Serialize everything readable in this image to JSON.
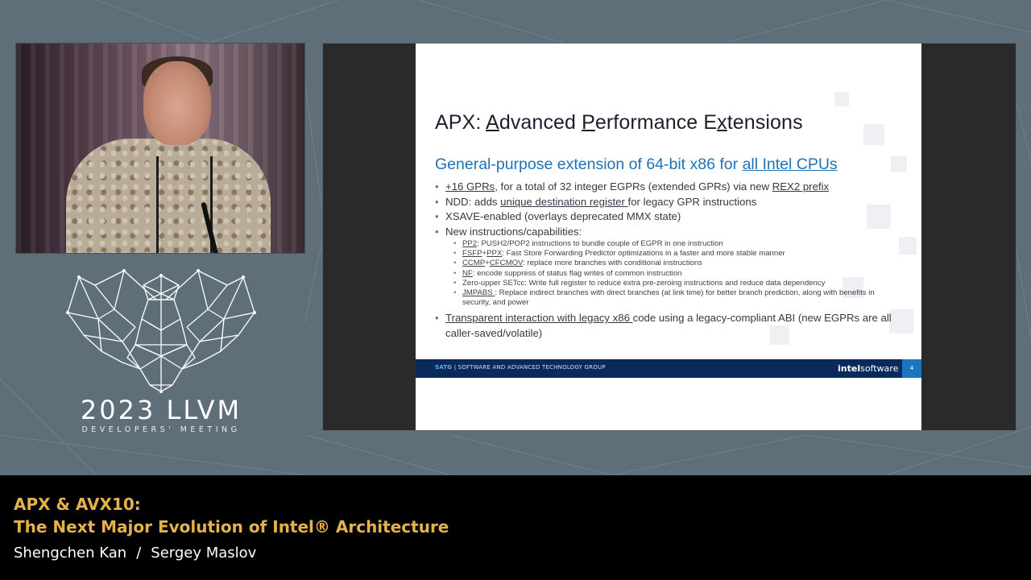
{
  "event": {
    "year_title": "2023 LLVM",
    "subtitle": "DEVELOPERS' MEETING"
  },
  "slide": {
    "title_parts": [
      "APX: ",
      "A",
      "dvanced ",
      "P",
      "erformance E",
      "x",
      "tensions"
    ],
    "subtitle_prefix": "General-purpose extension of 64-bit x86 for ",
    "subtitle_link": "all Intel CPUs",
    "bullets": [
      {
        "parts": [
          {
            "text": "+16 GPRs",
            "u": true
          },
          {
            "text": ", for a total of 32 integer EGPRs (extended GPRs) via new ",
            "u": false
          },
          {
            "text": "REX2 prefix",
            "u": true
          }
        ]
      },
      {
        "parts": [
          {
            "text": "NDD: adds ",
            "u": false
          },
          {
            "text": "unique destination register ",
            "u": true
          },
          {
            "text": "for legacy GPR instructions",
            "u": false
          }
        ]
      },
      {
        "parts": [
          {
            "text": "XSAVE-enabled (overlays deprecated MMX state)",
            "u": false
          }
        ]
      },
      {
        "parts": [
          {
            "text": "New instructions/capabilities:",
            "u": false
          }
        ],
        "sub": [
          [
            {
              "text": "PP2",
              "u": true
            },
            {
              "text": ": PUSH2/POP2 instructions to bundle couple of EGPR in one instruction",
              "u": false
            }
          ],
          [
            {
              "text": "FSFP",
              "u": true
            },
            {
              "text": "+",
              "u": false
            },
            {
              "text": "PPX",
              "u": true
            },
            {
              "text": ": Fast Store Forwarding Predictor optimizations in a faster and more stable manner",
              "u": false
            }
          ],
          [
            {
              "text": "CCMP",
              "u": true
            },
            {
              "text": "+",
              "u": false
            },
            {
              "text": "CFCMOV",
              "u": true
            },
            {
              "text": ": replace more branches with conditional instructions",
              "u": false
            }
          ],
          [
            {
              "text": "NF",
              "u": true
            },
            {
              "text": ": encode suppress of status flag writes of common instruction",
              "u": false
            }
          ],
          [
            {
              "text": "Zero-upper SETcc: Write full register to reduce extra pre-zeroing instructions and reduce data dependency",
              "u": false
            }
          ],
          [
            {
              "text": "JMPABS ",
              "u": true
            },
            {
              "text": ": Replace indirect branches with direct branches (at link time) for better branch prediction, along with benefits in security, and power",
              "u": false
            }
          ]
        ]
      },
      {
        "parts": [
          {
            "text": "Transparent interaction with legacy x86 ",
            "u": true
          },
          {
            "text": "code using a legacy-compliant ABI (new EGPRs are all caller-saved/volatile)",
            "u": false
          }
        ],
        "last": true
      }
    ],
    "footer": {
      "org_abbr": "SATG",
      "org_name": "| SOFTWARE AND ADVANCED TECHNOLOGY GROUP",
      "brand_a": "intel",
      "brand_b": "software",
      "page": "4"
    }
  },
  "talk": {
    "title_line1": "APX & AVX10:",
    "title_line2": "The Next Major Evolution of Intel® Architecture",
    "speaker1": "Shengchen Kan",
    "separator": "/",
    "speaker2": "Sergey Maslov"
  }
}
